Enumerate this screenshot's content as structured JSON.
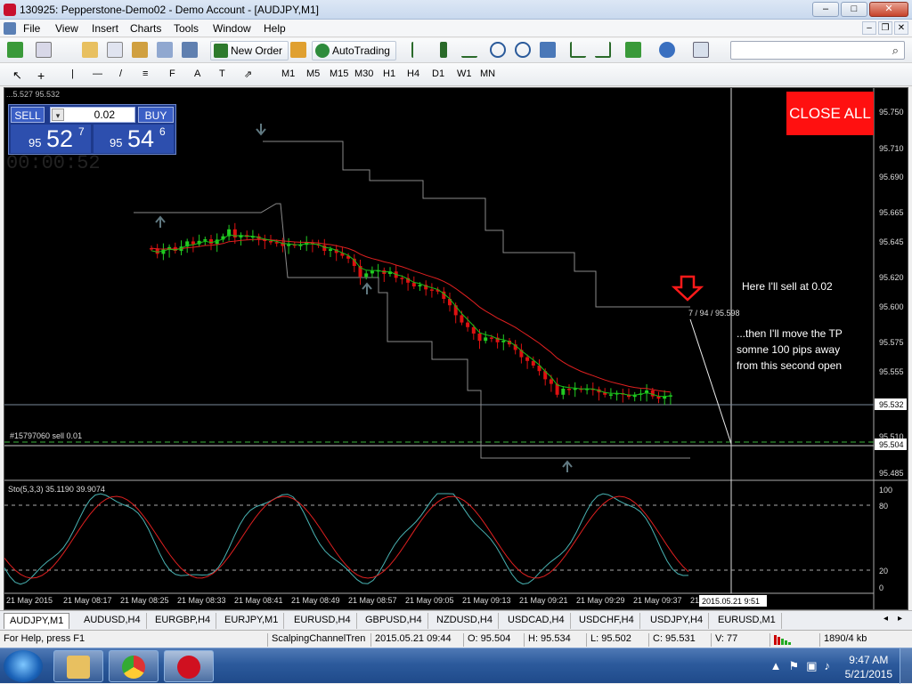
{
  "window": {
    "title": "130925: Pepperstone-Demo02 - Demo Account - [AUDJPY,M1]",
    "min": "–",
    "max": "□",
    "close": "✕"
  },
  "menu": {
    "items": [
      "File",
      "View",
      "Insert",
      "Charts",
      "Tools",
      "Window",
      "Help"
    ],
    "mdi": [
      "–",
      "❐",
      "✕"
    ]
  },
  "toolbar": {
    "new_order": "New Order",
    "autotrading": "AutoTrading",
    "search": {
      "value": "",
      "icon": "search-icon"
    },
    "timeframes": [
      "M1",
      "M5",
      "M15",
      "M30",
      "H1",
      "H4",
      "D1",
      "W1",
      "MN"
    ],
    "draw_tools": [
      "↖",
      "+",
      "|",
      "—",
      "/",
      "≡",
      "F",
      "A",
      "T",
      "⇗"
    ],
    "colors": {
      "autotrading_icon": "#2e8b3c",
      "new_order_icon": "#2d7a2d"
    }
  },
  "one_click": {
    "sell_label": "SELL",
    "buy_label": "BUY",
    "lot": "0.02",
    "bid": {
      "small": "95",
      "big": "52",
      "sup": "7"
    },
    "ask": {
      "small": "95",
      "big": "54",
      "sup": "6"
    }
  },
  "chart": {
    "header_text": "...5.527 95.532",
    "timer": "00:00:52",
    "close_all": "CLOSE ALL",
    "indicator_label": "Sto(5,3,3) 35.1190 39.9074",
    "order_label": "#15797060 sell 0.01",
    "tp_label": "7 / 94 / 95.598",
    "annotation_1": "Here I'll sell at 0.02",
    "annotation_2": [
      "...then I'll move the TP",
      "somne 100 pips away",
      "from this second open"
    ],
    "current_price": "95.532",
    "order_price": "95.504",
    "cursor_date": "2015.05.21 9:51",
    "osc_levels": [
      "100",
      "80",
      "20",
      "0"
    ],
    "colors": {
      "bull": "#22cc22",
      "bear": "#dd1111",
      "ma_red": "#e02020",
      "ma_green": "#18c018",
      "channel": "#8a8a8a",
      "stoch_main": "#49b3b3",
      "stoch_signal": "#e02020",
      "arrow": "#607880"
    }
  },
  "chart_data": {
    "type": "candlestick",
    "symbol": "AUDJPY",
    "timeframe": "M1",
    "y_ticks": [
      "95.750",
      "95.710",
      "95.690",
      "95.665",
      "95.645",
      "95.620",
      "95.600",
      "95.575",
      "95.555",
      "95.532",
      "95.510",
      "95.504",
      "95.485"
    ],
    "x_ticks": [
      "21 May 2015",
      "21 May 08:17",
      "21 May 08:25",
      "21 May 08:33",
      "21 May 08:41",
      "21 May 08:49",
      "21 May 08:57",
      "21 May 09:05",
      "21 May 09:13",
      "21 May 09:21",
      "21 May 09:29",
      "21 May 09:37",
      "21"
    ]
  },
  "symbol_tabs": [
    "AUDJPY,M1",
    "AUDUSD,H4",
    "EURGBP,H4",
    "EURJPY,M1",
    "EURUSD,H4",
    "GBPUSD,H4",
    "NZDUSD,H4",
    "USDCAD,H4",
    "USDCHF,H4",
    "USDJPY,H4",
    "EURUSD,M1"
  ],
  "status": {
    "help": "For Help, press F1",
    "profile": "ScalpingChannelTren",
    "datetime": "2015.05.21 09:44",
    "open": "O: 95.504",
    "high": "H: 95.534",
    "low": "L: 95.502",
    "close": "C: 95.531",
    "volume": "V: 77",
    "traffic": "1890/4 kb"
  },
  "taskbar": {
    "time": "9:47 AM",
    "date": "5/21/2015",
    "tray": [
      "▲",
      "⚑",
      "▣",
      "♪"
    ]
  }
}
